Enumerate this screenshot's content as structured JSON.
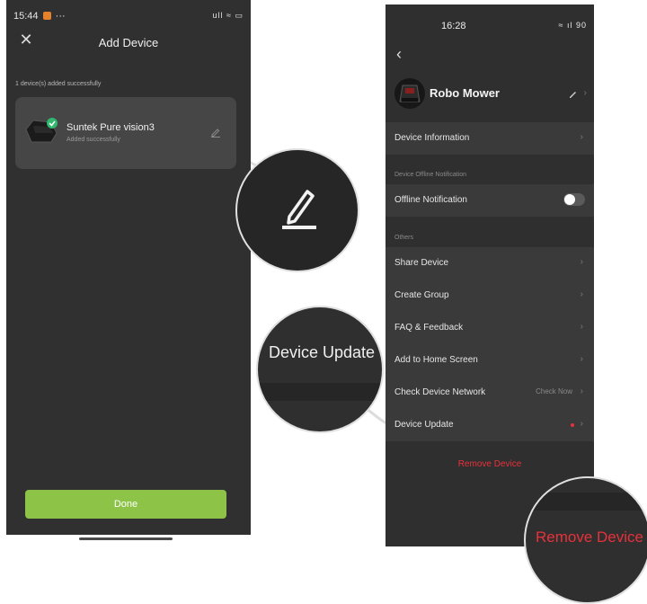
{
  "left_phone": {
    "status_time": "15:44",
    "status_extra": "···",
    "status_icons": "ull ≈ ▭",
    "header": {
      "close_icon": "close-icon",
      "title": "Add Device"
    },
    "added_message": "1 device(s) added successfully",
    "device": {
      "name": "Suntek Pure vision3",
      "status": "Added successfully"
    },
    "done_label": "Done"
  },
  "right_phone": {
    "status_time": "16:28",
    "status_icons": "≈ ıl 90",
    "device_title": "Robo Mower",
    "rows": {
      "device_information": "Device Information",
      "offline_section": "Device Offline Notification",
      "offline_notification": "Offline Notification",
      "others_section": "Others",
      "share_device": "Share Device",
      "create_group": "Create Group",
      "faq_feedback": "FAQ & Feedback",
      "add_to_home": "Add to Home Screen",
      "check_network": "Check Device Network",
      "check_now": "Check Now",
      "device_update": "Device Update"
    },
    "offline_toggle_on": false,
    "remove_device": "Remove Device"
  },
  "callouts": {
    "pencil_icon": "edit-icon",
    "device_update": "Device Update",
    "remove_device": "Remove Device"
  },
  "colors": {
    "accent_green": "#8dc347",
    "danger_red": "#e8313b",
    "bg_dark": "#303030"
  }
}
